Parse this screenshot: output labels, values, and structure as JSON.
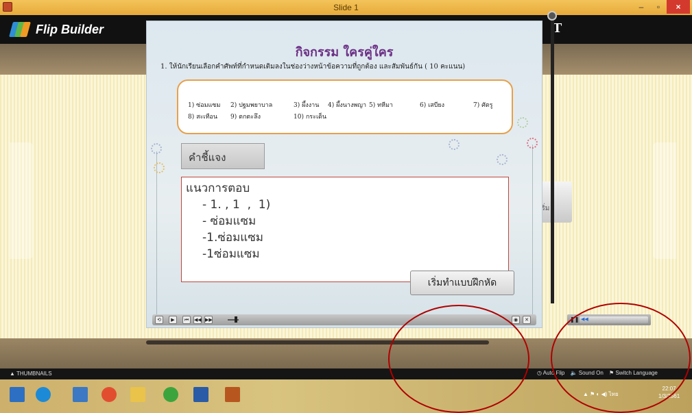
{
  "window": {
    "title": "Slide 1",
    "minimize": "–",
    "maximize": "▫",
    "close": "×"
  },
  "header": {
    "logo_text": "Flip Builder",
    "right_letter": "T"
  },
  "slide": {
    "title": "กิจกรรม ใครคู่ใคร",
    "instruction": "1. ให้นักเรียนเลือกคำศัพท์ที่กำหนดเติมลงในช่องว่างหน้าข้อความที่ถูกต้อง และสัมพันธ์กัน  ( 10 คะแนน)",
    "words": [
      "1) ซ่อมแซม",
      "2) ปฐมพยาบาล",
      "3) ผึ้งงาน",
      "4) ผึ้งนางพญา",
      "5) ทหีมา",
      "6) เสบียง",
      "7) ศัตรู",
      "8) สะเทือน",
      "9) ตกตะลึง",
      "10) กระเด็น"
    ],
    "instructions_tab": "คำชี้แจง",
    "answer_lines": [
      "แนวการตอบ",
      "- 1. , 1  ,  1)",
      "- ซ่อมแซม",
      "-1.ซ่อมแซม",
      "-1ซ่อมแซม"
    ],
    "start_button": "เริ่มทำแบบฝึกหัด"
  },
  "player": {
    "buttons": [
      "⟲",
      "▶",
      "⏮",
      "◀◀",
      "▶▶"
    ],
    "right_buttons": [
      "◉",
      "✕"
    ],
    "mini_pause": "❚❚",
    "mini_volume": "◀◀"
  },
  "under_card_text": "เริ่ม",
  "bottom_bar": {
    "thumbnails": "▲ THUMBNAILS",
    "auto_flip": "Auto Flip",
    "sound": "Sound On",
    "switch_language": "Switch Language"
  },
  "taskbar": {
    "tray_lang": "ไทย",
    "time": "22:07",
    "date": "1/3/2561"
  },
  "colors": {
    "accent_title": "#6b2f84",
    "word_box_border": "#e7a04a",
    "answer_border": "#c0443b",
    "annotation": "#b00000"
  }
}
